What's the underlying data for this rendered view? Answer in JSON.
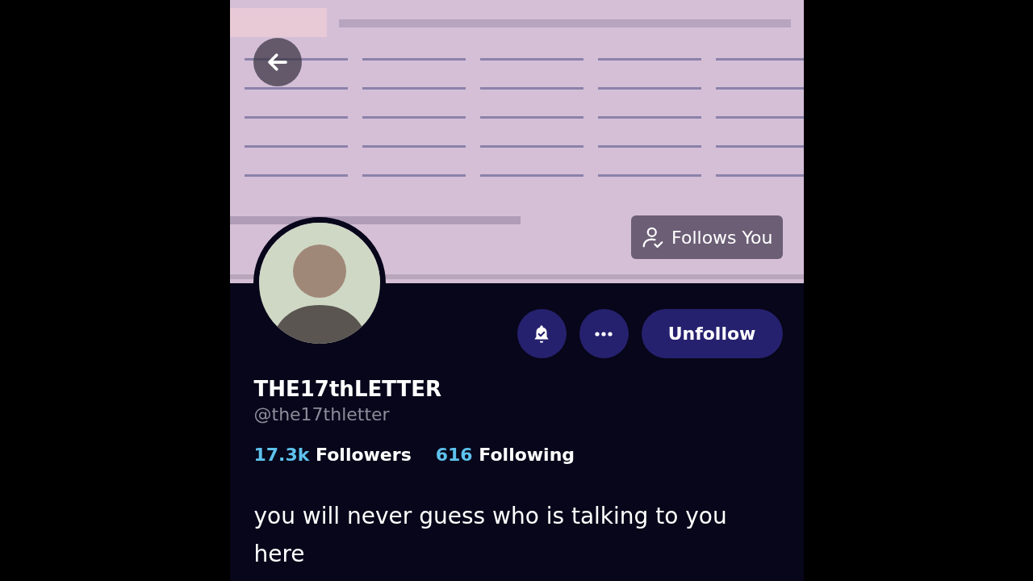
{
  "follows_you": {
    "label": "Follows You"
  },
  "profile": {
    "display_name": "THE17thLETTER",
    "handle": "@the17thletter"
  },
  "actions": {
    "notifications_on": true,
    "follow_button": "Unfollow"
  },
  "stats": [
    {
      "count": "17.3k",
      "label": "Followers"
    },
    {
      "count": "616",
      "label": "Following"
    }
  ],
  "bio": "you will never guess who is talking to you here"
}
